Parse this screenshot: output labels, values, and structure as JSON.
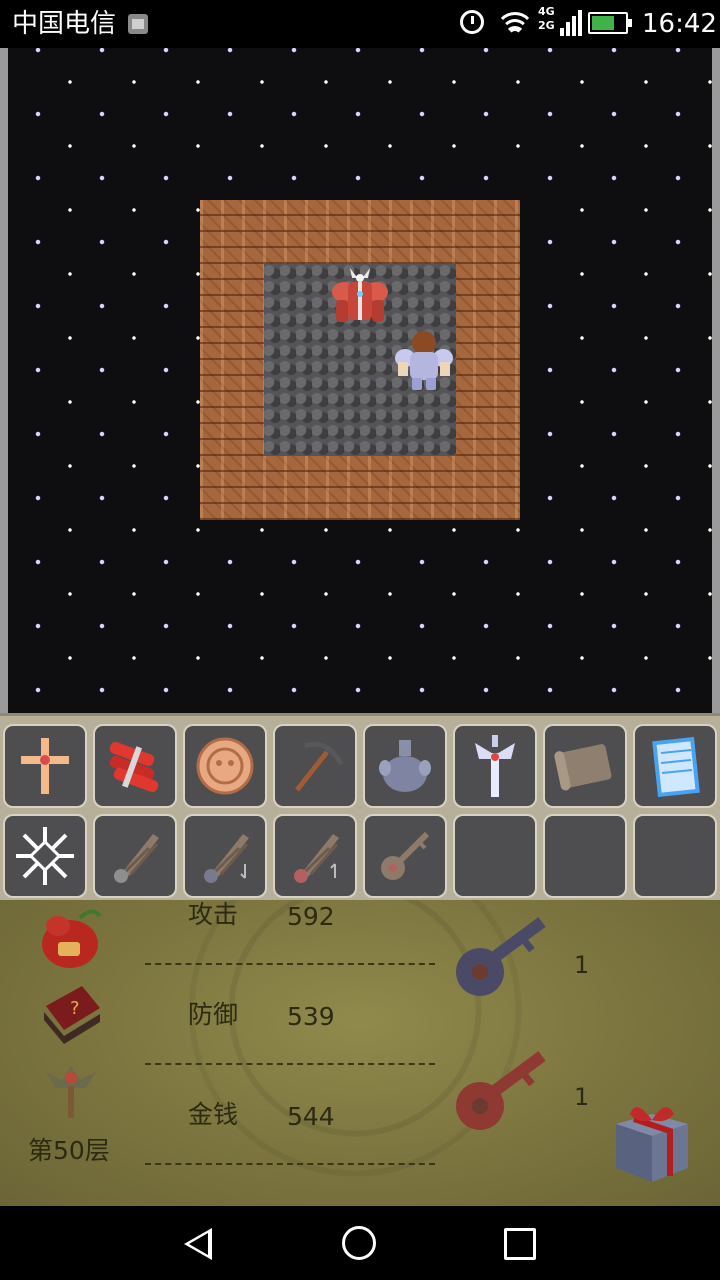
{
  "status_bar": {
    "carrier": "中国电信",
    "network_4g": "4G",
    "network_2g": "2G",
    "time": "16:42"
  },
  "map": {
    "monster": "red-armored-knight",
    "hero": "brave-hero"
  },
  "items": [
    {
      "name": "holy-cross",
      "icon": "cross-icon"
    },
    {
      "name": "dynamite",
      "icon": "dynamite-icon"
    },
    {
      "name": "lucky-coin",
      "icon": "coin-icon"
    },
    {
      "name": "pickaxe",
      "icon": "pickaxe-icon"
    },
    {
      "name": "holy-water",
      "icon": "flask-icon"
    },
    {
      "name": "holy-sword",
      "icon": "sword-icon"
    },
    {
      "name": "scroll",
      "icon": "scroll-icon"
    },
    {
      "name": "notepad",
      "icon": "notepad-icon"
    },
    {
      "name": "ice-magic",
      "icon": "snowflake-icon"
    },
    {
      "name": "fly-wing",
      "icon": "wing-icon"
    },
    {
      "name": "fly-down",
      "icon": "wing-down-icon"
    },
    {
      "name": "fly-up",
      "icon": "wing-up-icon"
    },
    {
      "name": "master-key",
      "icon": "key-icon"
    },
    {
      "name": "empty",
      "icon": ""
    },
    {
      "name": "empty",
      "icon": ""
    },
    {
      "name": "empty",
      "icon": ""
    }
  ],
  "panel": {
    "attack_label": "攻击",
    "attack_value": "592",
    "defense_label": "防御",
    "defense_value": "539",
    "gold_label": "金钱",
    "gold_value": "544",
    "floor": "第50层",
    "blue_key_count": "1",
    "red_key_count": "1"
  },
  "colors": {
    "wall": "#a5683e",
    "floor": "#555558",
    "panel": "#7d7640",
    "slot": "#4e4e50"
  }
}
